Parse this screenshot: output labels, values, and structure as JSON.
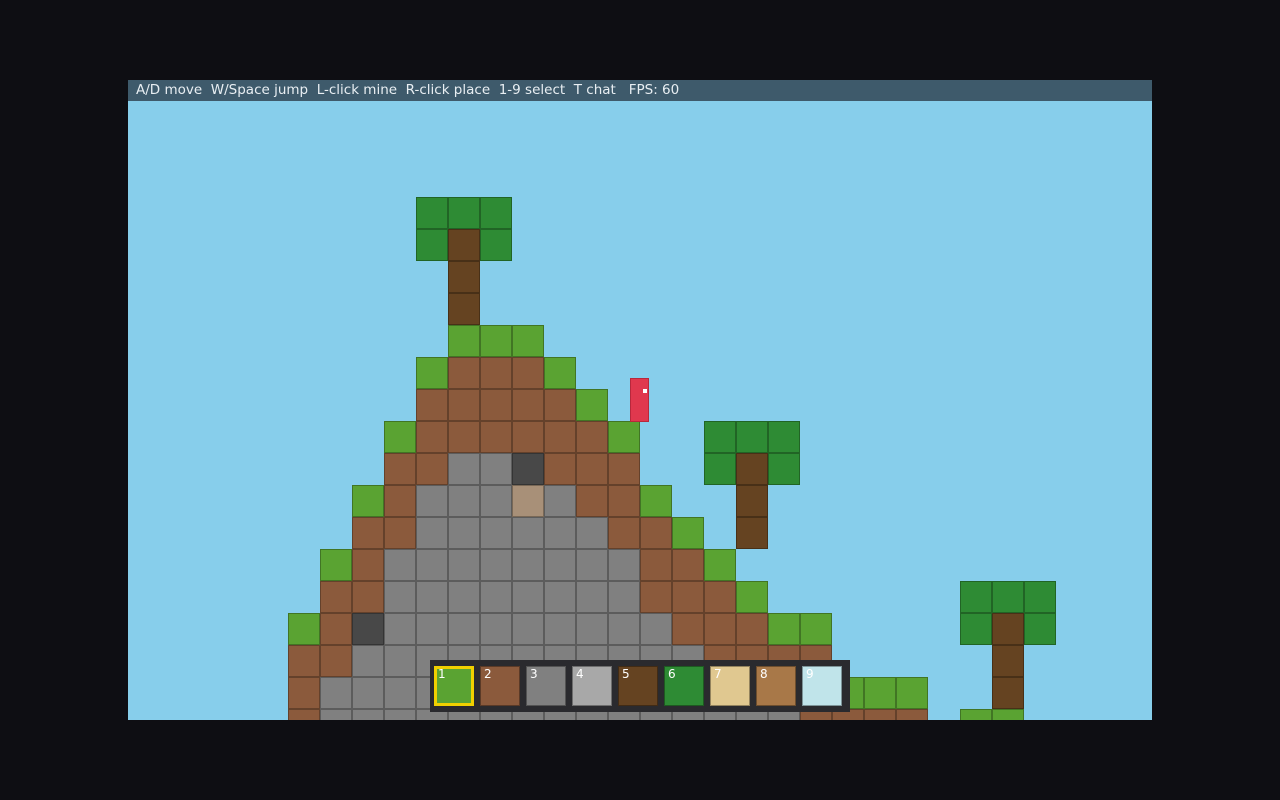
{
  "hud": {
    "controls": "A/D move  W/Space jump  L-click mine  R-click place  1-9 select  T chat",
    "fps_label": "FPS: 60"
  },
  "colors": {
    "sky": "#87ceeb",
    "grass": "#5aa332",
    "dirt": "#8b5a3c",
    "stone": "#808080",
    "dark_stone": "#484848",
    "wood": "#654321",
    "leaves": "#2e8b34",
    "sand": "#a89078",
    "player": "#e0384e"
  },
  "world_rows": [
    ".........LLL....................",
    ".........LWL....................",
    "..........W.....................",
    "..........W.....................",
    "..........GGG...................",
    ".........GDDDG..................",
    ".........DDDDDG.................",
    "........GDDDDDDG..LLL...........",
    "........DDSSKDDD..LWL...........",
    ".......GDSSSASDDG..W............",
    ".......DDSSSSSSDDG.W............",
    "......GDSSSSSSSSDDG.............",
    "......DDSSSSSSSSDDDG......LLL...",
    ".....GDKSSSSSSSSSDDDGG....LWL...",
    ".....DDSSSSSSSSSSSDDDD.....W....",
    ".....DSSSSSSSSSSSSSDDDGGG..W....",
    ".....DSSSSSSSSSSSSSSSDDDD.GG...."
  ],
  "hotbar": {
    "selected": 1,
    "slots": [
      {
        "num": "1",
        "block": "grass",
        "color": "#5aa332"
      },
      {
        "num": "2",
        "block": "dirt",
        "color": "#8b5a3c"
      },
      {
        "num": "3",
        "block": "stone",
        "color": "#808080"
      },
      {
        "num": "4",
        "block": "light-stone",
        "color": "#a8a8a8"
      },
      {
        "num": "5",
        "block": "wood",
        "color": "#654321"
      },
      {
        "num": "6",
        "block": "leaves",
        "color": "#2e8b34"
      },
      {
        "num": "7",
        "block": "sand",
        "color": "#e0c890"
      },
      {
        "num": "8",
        "block": "planks",
        "color": "#a87848"
      },
      {
        "num": "9",
        "block": "glass",
        "color": "#c0e4ea"
      }
    ]
  }
}
